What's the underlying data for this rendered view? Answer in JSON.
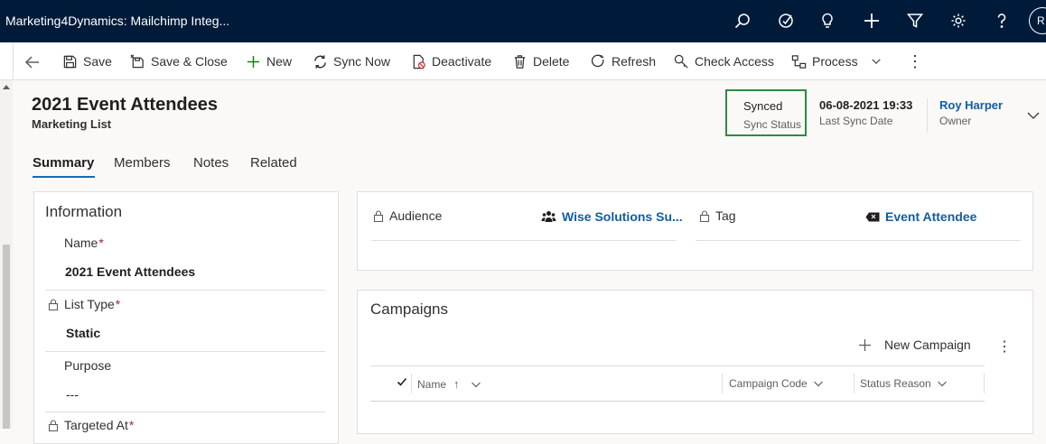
{
  "app": {
    "title": "Marketing4Dynamics: Mailchimp Integ..."
  },
  "topbar": {
    "icons": [
      "search-icon",
      "target-icon",
      "lightbulb-icon",
      "plus-icon",
      "filter-icon",
      "gear-icon",
      "help-icon"
    ],
    "avatar_initials": "R"
  },
  "commandbar": {
    "save": "Save",
    "save_close": "Save & Close",
    "new": "New",
    "sync_now": "Sync Now",
    "deactivate": "Deactivate",
    "delete": "Delete",
    "refresh": "Refresh",
    "check_access": "Check Access",
    "process": "Process"
  },
  "record": {
    "title": "2021 Event Attendees",
    "entity": "Marketing List"
  },
  "header_fields": {
    "sync_status": {
      "value": "Synced",
      "label": "Sync Status"
    },
    "last_sync": {
      "value": "06-08-2021 19:33",
      "label": "Last Sync Date"
    },
    "owner": {
      "value": "Roy Harper",
      "label": "Owner"
    }
  },
  "tabs": [
    "Summary",
    "Members",
    "Notes",
    "Related"
  ],
  "information": {
    "title": "Information",
    "name_label": "Name",
    "name_value": "2021 Event Attendees",
    "list_type_label": "List Type",
    "list_type_value": "Static",
    "purpose_label": "Purpose",
    "purpose_value": "---",
    "targeted_at_label": "Targeted At",
    "required_mark": "*"
  },
  "audience": {
    "audience_label": "Audience",
    "audience_value": "Wise Solutions Su...",
    "tag_label": "Tag",
    "tag_value": "Event Attendee"
  },
  "campaigns": {
    "title": "Campaigns",
    "new_campaign": "New Campaign",
    "columns": [
      "Name",
      "Campaign Code",
      "Status Reason"
    ],
    "sort_indicator": "↑"
  },
  "colors": {
    "topbar_bg": "#001b3a",
    "link": "#115ea3",
    "synced_border": "#2e8b3f",
    "required": "#a4262c",
    "tab_underline": "#0f6cbd"
  }
}
